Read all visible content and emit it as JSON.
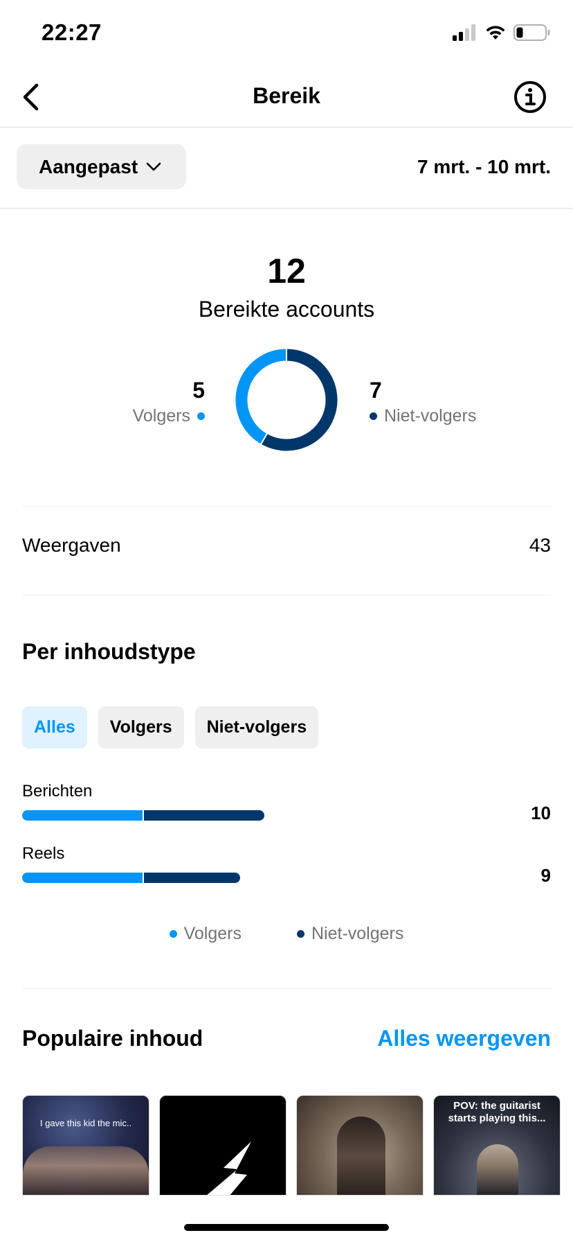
{
  "status_bar": {
    "time": "22:27"
  },
  "nav": {
    "title": "Bereik"
  },
  "filter": {
    "label": "Aangepast",
    "date_range": "7 mrt. - 10 mrt."
  },
  "summary": {
    "total": "12",
    "total_label": "Bereikte accounts",
    "followers_count": "5",
    "followers_label": "Volgers",
    "non_followers_count": "7",
    "non_followers_label": "Niet-volgers"
  },
  "chart_data": [
    {
      "type": "pie",
      "title": "Bereikte accounts",
      "categories": [
        "Volgers",
        "Niet-volgers"
      ],
      "values": [
        5,
        7
      ],
      "colors": [
        "#0095f6",
        "#00376b"
      ],
      "donut": true
    },
    {
      "type": "bar",
      "orientation": "horizontal",
      "stacked": true,
      "categories": [
        "Berichten",
        "Reels"
      ],
      "totals": [
        10,
        9
      ],
      "series": [
        {
          "name": "Volgers",
          "values": [
            5,
            5
          ],
          "color": "#0095f6"
        },
        {
          "name": "Niet-volgers",
          "values": [
            5,
            4
          ],
          "color": "#00376b"
        }
      ],
      "legend": "bottom-center"
    }
  ],
  "views": {
    "label": "Weergaven",
    "value": "43"
  },
  "content_type": {
    "title": "Per inhoudstype",
    "tabs": [
      {
        "label": "Alles",
        "active": true
      },
      {
        "label": "Volgers",
        "active": false
      },
      {
        "label": "Niet-volgers",
        "active": false
      }
    ],
    "rows": [
      {
        "label": "Berichten",
        "value": "10"
      },
      {
        "label": "Reels",
        "value": "9"
      }
    ],
    "legend": [
      "Volgers",
      "Niet-volgers"
    ]
  },
  "popular": {
    "title": "Populaire inhoud",
    "see_all": "Alles weergeven",
    "thumbs": [
      {
        "caption": "I gave this kid the mic.."
      },
      {
        "caption": ""
      },
      {
        "caption": ""
      },
      {
        "caption": "POV: the guitarist starts playing this..."
      }
    ]
  },
  "colors": {
    "followers": "#0095f6",
    "non_followers": "#00376b",
    "accent": "#0095f6"
  }
}
